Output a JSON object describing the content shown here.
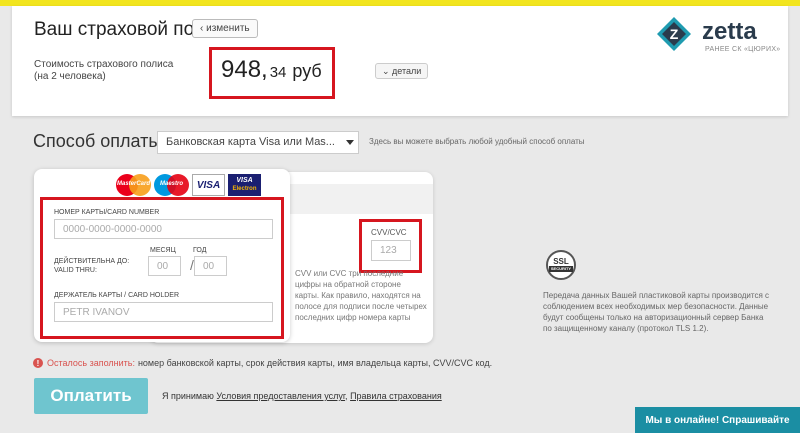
{
  "policy": {
    "title": "Ваш страховой полис",
    "change_label": "‹ изменить",
    "cost_label_line1": "Стоимость страхового полиса",
    "cost_label_line2": "(на 2 человека)",
    "price_main": "948,",
    "price_cents": "34",
    "price_currency": "руб",
    "details_label": "⌄ детали"
  },
  "brand": {
    "name": "zetta",
    "subtitle": "РАНЕЕ СК «ЦЮРИХ»",
    "logo_letter": "Z",
    "color_teal": "#1f9bb0",
    "color_dark": "#2a3b4c"
  },
  "payment": {
    "title": "Способ оплаты",
    "method_selected": "Банковская карта Visa или Mas...",
    "hint": "Здесь вы можете выбрать любой удобный способ оплаты"
  },
  "card_logos": {
    "mastercard": "MasterCard",
    "maestro": "Maestro",
    "visa": "VISA",
    "visa_electron_top": "VISA",
    "visa_electron_bottom": "Electron"
  },
  "card_front": {
    "number_label": "НОМЕР КАРТЫ/CARD NUMBER",
    "number_placeholder": "0000-0000-0000-0000",
    "valid_label_line1": "ДЕЙСТВИТЕЛЬНА ДО:",
    "valid_label_line2": "VALID THRU:",
    "month_label": "МЕСЯЦ",
    "year_label": "ГОД",
    "month_placeholder": "00",
    "year_placeholder": "00",
    "separator": "/",
    "holder_label": "ДЕРЖАТЕЛЬ КАРТЫ / CARD HOLDER",
    "holder_placeholder": "PETR IVANOV"
  },
  "card_back": {
    "cvv_label": "CVV/CVC",
    "cvv_placeholder": "123",
    "cvv_help": "CVV или CVC три последние цифры на обратной стороне карты. Как правило, находятся на полосе для подписи после четырех последних цифр номера карты"
  },
  "ssl": {
    "badge_top": "SSL",
    "badge_bottom": "SECURITY",
    "text": "Передача данных Вашей пластиковой карты производится с соблюдением всех необходимых мер безопасности. Данные будут сообщены только на авторизационный сервер Банка по защищенному каналу (протокол TLS 1.2)."
  },
  "remaining": {
    "icon": "!",
    "prefix": "Осталось заполнить:",
    "fields": "номер банковской карты, срок действия карты, имя владельца карты, CVV/CVC код."
  },
  "actions": {
    "pay_label": "Оплатить",
    "agree_prefix": "Я принимаю",
    "terms_link": "Условия предоставления услуг",
    "comma": ",",
    "rules_link": "Правила страхования"
  },
  "chat": {
    "label": "Мы в онлайне! Спрашивайте"
  },
  "colors": {
    "highlight_red": "#d6161f",
    "pay_button": "#6fc5cf",
    "chat_tab": "#1b8ea3",
    "top_stripe": "#f2e51e"
  }
}
